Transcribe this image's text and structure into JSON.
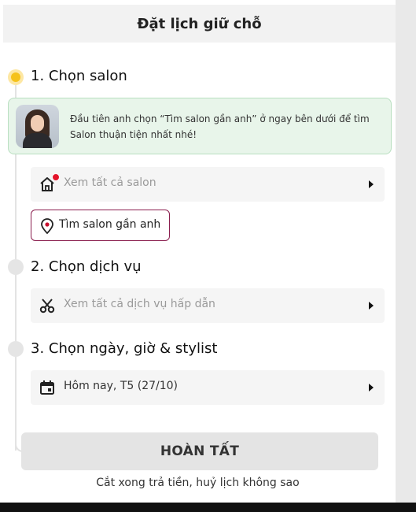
{
  "header": {
    "title": "Đặt lịch giữ chỗ"
  },
  "steps": [
    {
      "title": "1. Chọn salon",
      "status": "active"
    },
    {
      "title": "2. Chọn dịch vụ",
      "status": "inactive"
    },
    {
      "title": "3. Chọn ngày, giờ & stylist",
      "status": "inactive"
    }
  ],
  "hint": {
    "text": "Đầu tiên anh chọn “Tìm salon gần anh” ở ngay bên dưới để tìm Salon thuận tiện nhất nhé!",
    "avatar_icon": "stylist-avatar"
  },
  "salon": {
    "placeholder": "Xem tất cả salon",
    "icon": "home-icon",
    "notification_color": "#e3152b",
    "near_button_label": "Tìm salon gần anh",
    "near_icon": "location-pin-icon"
  },
  "service": {
    "placeholder": "Xem tất cả dịch vụ hấp dẫn",
    "icon": "scissors-icon"
  },
  "date": {
    "value": "Hôm nay, T5 (27/10)",
    "icon": "calendar-icon"
  },
  "actions": {
    "finish_label": "HOÀN TẤT",
    "footnote": "Cắt xong trả tiền, huỷ lịch không sao"
  },
  "colors": {
    "accent": "#8a1e4e",
    "active_step": "#f5c21b",
    "hint_background": "#e8f5ea"
  }
}
